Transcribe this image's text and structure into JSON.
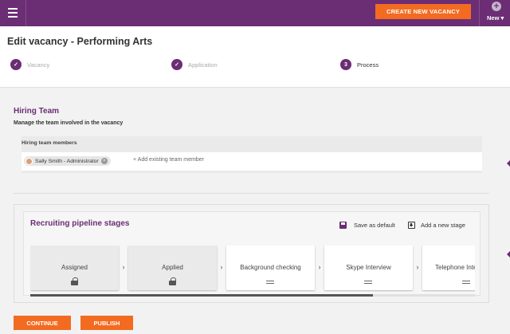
{
  "topbar": {
    "create_label": "CREATE NEW VACANCY",
    "new_label": "New ▾",
    "plus": "+"
  },
  "header": {
    "title": "Edit vacancy - Performing Arts",
    "steps": [
      {
        "number": "✓",
        "label": "Vacancy",
        "done": true
      },
      {
        "number": "✓",
        "label": "Application",
        "done": true
      },
      {
        "number": "3",
        "label": "Process",
        "done": false
      }
    ]
  },
  "hiring": {
    "title": "Hiring Team",
    "subtitle": "Manage the team involved in the vacancy",
    "members_label": "Hiring team members",
    "member_chip": "Sally Smith - Administrator",
    "chip_close": "×",
    "add_placeholder": "+ Add existing team member"
  },
  "pipeline": {
    "title": "Recruiting pipeline stages",
    "save_default": "Save as default",
    "add_stage": "Add a new stage",
    "arrow": "›",
    "stages": [
      {
        "label": "Assigned",
        "locked": true
      },
      {
        "label": "Applied",
        "locked": true
      },
      {
        "label": "Background checking",
        "locked": false
      },
      {
        "label": "Skype Interview",
        "locked": false
      },
      {
        "label": "Telephone Interview",
        "locked": false
      }
    ],
    "scroll_fraction": 0.77
  },
  "actions": {
    "continue_label": "CONTINUE",
    "publish_label": "PUBLISH"
  },
  "colors": {
    "brand": "#6b2d74",
    "accent": "#f36b21"
  }
}
